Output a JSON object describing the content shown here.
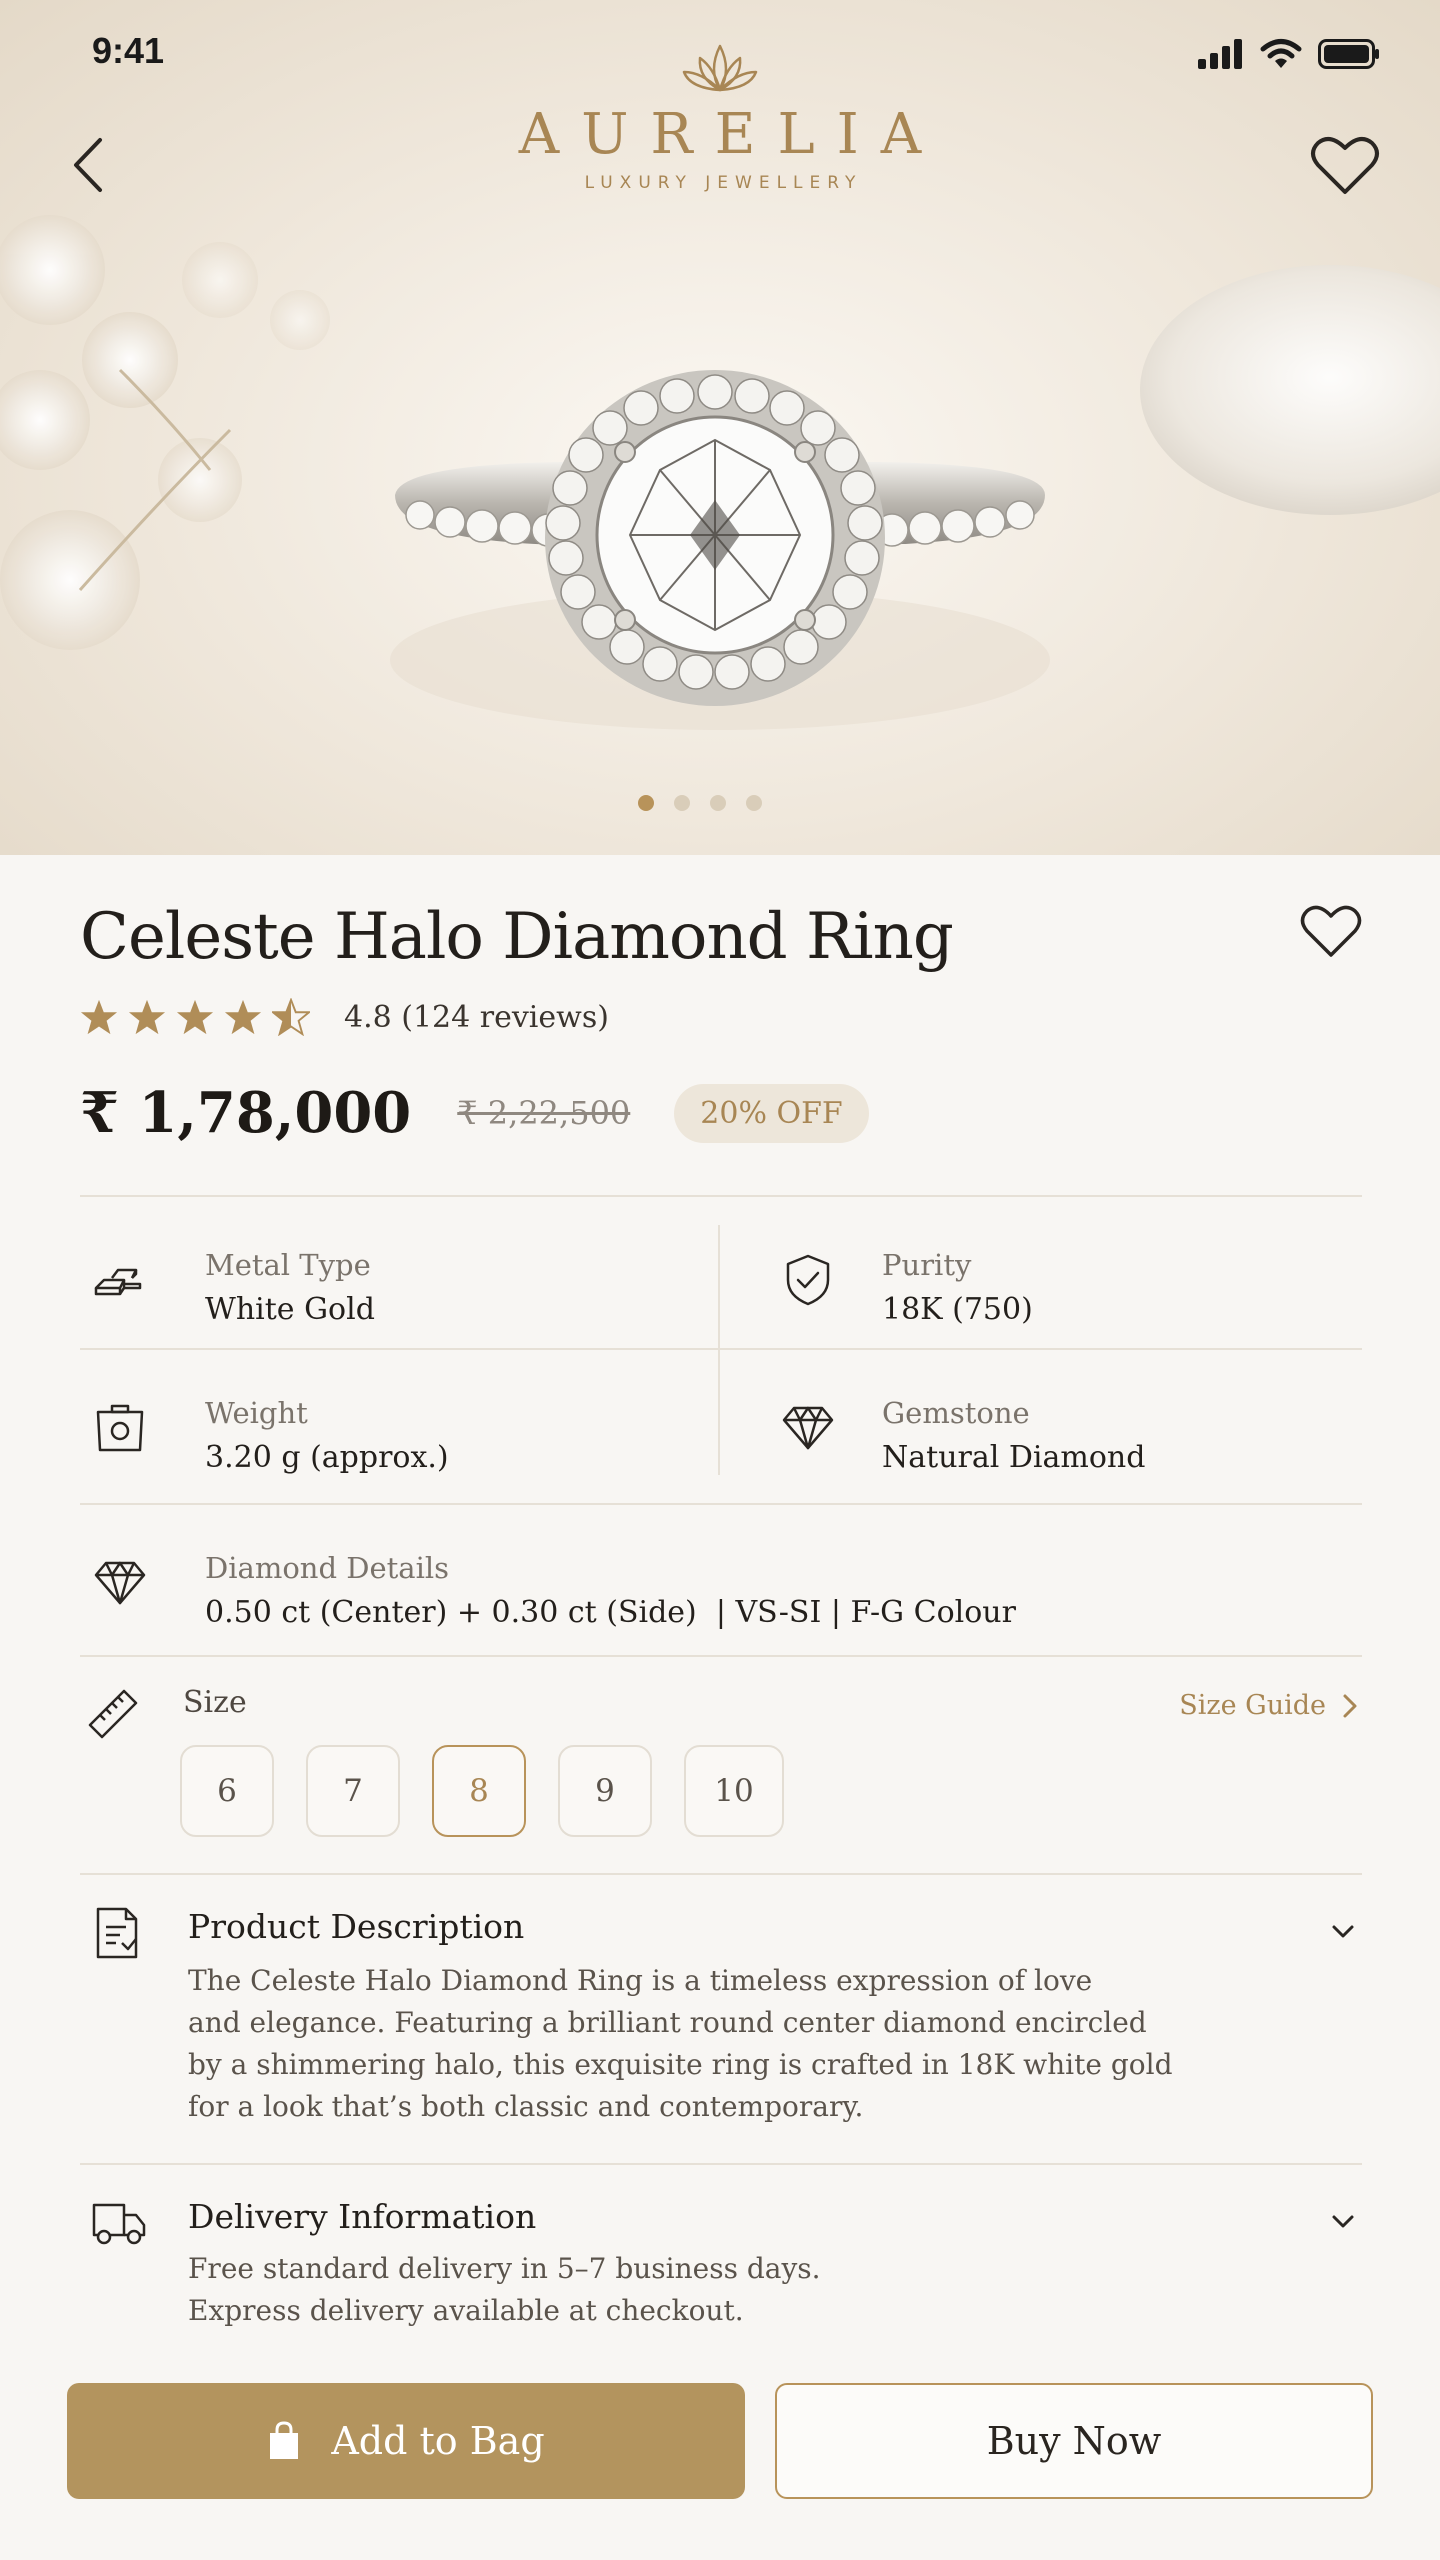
{
  "status": {
    "time": "9:41"
  },
  "brand": {
    "name": "AURELIA",
    "tagline": "LUXURY JEWELLERY"
  },
  "carousel": {
    "count": 4,
    "active": 0
  },
  "product": {
    "title": "Celeste Halo Diamond Ring",
    "rating": 4.5,
    "rating_text": "4.8 (124 reviews)",
    "price": "₹ 1,78,000",
    "old_price": "₹ 2,22,500",
    "discount": "20% OFF"
  },
  "specs": {
    "metal": {
      "label": "Metal Type",
      "value": "White Gold",
      "icon": "gold-bars-icon"
    },
    "purity": {
      "label": "Purity",
      "value": "18K (750)",
      "icon": "shield-check-icon"
    },
    "weight": {
      "label": "Weight",
      "value": "3.20 g (approx.)",
      "icon": "scale-icon"
    },
    "gemstone": {
      "label": "Gemstone",
      "value": "Natural Diamond",
      "icon": "diamond-icon"
    },
    "diamond": {
      "label": "Diamond Details",
      "value": "0.50 ct (Center) + 0.30 ct (Side)  | VS-SI | F-G Colour",
      "icon": "diamond-icon"
    }
  },
  "size": {
    "label": "Size",
    "guide": "Size Guide",
    "options": [
      "6",
      "7",
      "8",
      "9",
      "10"
    ],
    "selected": "8"
  },
  "description": {
    "title": "Product Description",
    "lines": [
      "The Celeste Halo Diamond Ring is a timeless expression of love",
      "and elegance. Featuring a brilliant round center diamond encircled",
      "by a shimmering halo, this exquisite ring is crafted in 18K white gold",
      "for a look that’s both classic and contemporary."
    ]
  },
  "delivery": {
    "title": "Delivery Information",
    "lines": [
      "Free standard delivery in 5–7 business days.",
      "Express delivery available at checkout."
    ]
  },
  "actions": {
    "add_to_bag": "Add to Bag",
    "buy_now": "Buy Now"
  },
  "colors": {
    "accent": "#b3945e",
    "background": "#f8f6f3",
    "text": "#231f1b"
  }
}
